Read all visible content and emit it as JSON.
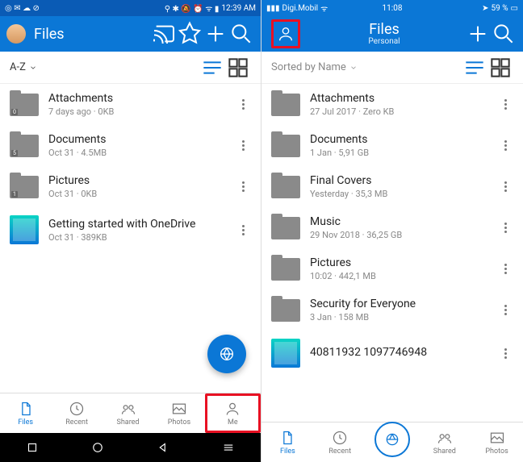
{
  "left": {
    "status": {
      "time": "12:39 AM"
    },
    "title": "Files",
    "sort": "A-Z",
    "items": [
      {
        "name": "Attachments",
        "meta": "7 days ago · 0KB",
        "badge": "0",
        "type": "folder"
      },
      {
        "name": "Documents",
        "meta": "Oct 31 · 4.5MB",
        "badge": "5",
        "type": "folder"
      },
      {
        "name": "Pictures",
        "meta": "Oct 31 · 0KB",
        "badge": "1",
        "type": "folder"
      },
      {
        "name": "Getting started with OneDrive",
        "meta": "Oct 31 · 389KB",
        "type": "file"
      }
    ],
    "tabs": [
      {
        "label": "Files",
        "icon": "file",
        "active": true
      },
      {
        "label": "Recent",
        "icon": "clock"
      },
      {
        "label": "Shared",
        "icon": "shared"
      },
      {
        "label": "Photos",
        "icon": "photos"
      },
      {
        "label": "Me",
        "icon": "person",
        "highlight": true
      }
    ]
  },
  "right": {
    "status": {
      "carrier": "Digi.Mobil",
      "time": "11:08",
      "battery": "59 %"
    },
    "title": "Files",
    "subtitle": "Personal",
    "sort": "Sorted by Name",
    "items": [
      {
        "name": "Attachments",
        "meta": "27 Jul 2017 · Zero KB",
        "type": "folder"
      },
      {
        "name": "Documents",
        "meta": "1 Jan · 5,91 GB",
        "type": "folder"
      },
      {
        "name": "Final Covers",
        "meta": "Yesterday · 35,3 MB",
        "type": "folder"
      },
      {
        "name": "Music",
        "meta": "29 Nov 2018 · 36,25 GB",
        "type": "folder"
      },
      {
        "name": "Pictures",
        "meta": "10:02 · 442,1 MB",
        "type": "folder"
      },
      {
        "name": "Security for Everyone",
        "meta": "3 Jan · 158 MB",
        "type": "folder"
      },
      {
        "name": "40811932 1097746948",
        "meta": "",
        "type": "file"
      }
    ],
    "tabs": [
      {
        "label": "Files",
        "icon": "file",
        "active": true
      },
      {
        "label": "Recent",
        "icon": "clock"
      },
      {
        "label": "",
        "icon": "scan",
        "center": true
      },
      {
        "label": "Shared",
        "icon": "shared"
      },
      {
        "label": "Photos",
        "icon": "photos"
      }
    ]
  }
}
